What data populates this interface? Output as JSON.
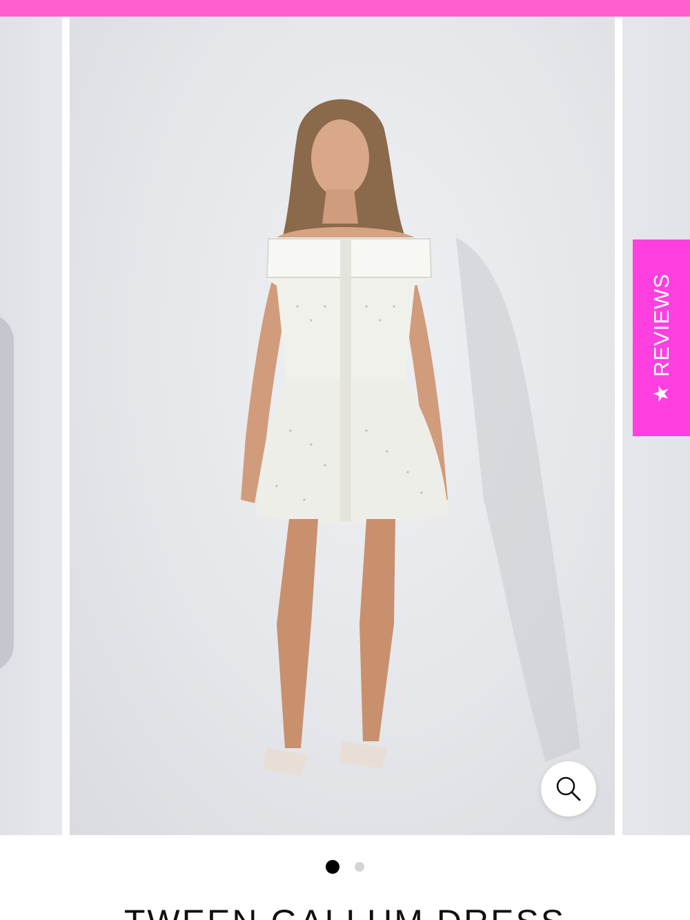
{
  "banner": {
    "color": "#ff5fcf"
  },
  "carousel": {
    "slide_count": 2,
    "active_index": 0,
    "image_alt": "Model wearing white polka dot off-shoulder dress"
  },
  "zoom": {
    "icon": "magnifier-icon"
  },
  "reviews_tab": {
    "label": "REVIEWS",
    "icon": "star-icon",
    "color": "#ff3fe0"
  },
  "product": {
    "title": "TWEEN GALLUM DRESS"
  }
}
